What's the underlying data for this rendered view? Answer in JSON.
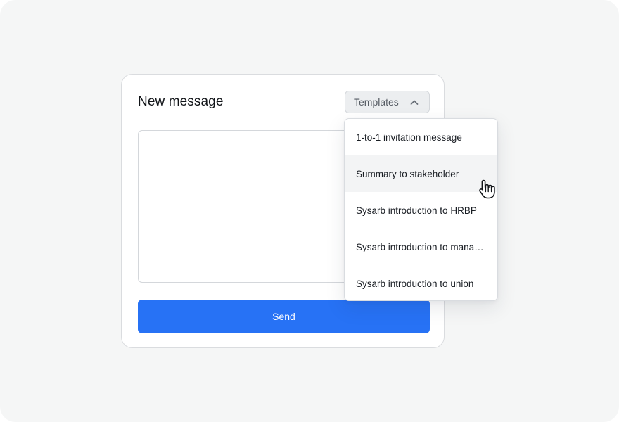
{
  "card": {
    "title": "New message",
    "templates_label": "Templates",
    "message_value": "",
    "send_label": "Send"
  },
  "dropdown": {
    "items": [
      {
        "label": "1-to-1 invitation message",
        "hovered": false
      },
      {
        "label": "Summary to stakeholder",
        "hovered": true
      },
      {
        "label": "Sysarb introduction to HRBP",
        "hovered": false
      },
      {
        "label": "Sysarb introduction to mana…",
        "hovered": false
      },
      {
        "label": "Sysarb introduction to union",
        "hovered": false
      }
    ]
  },
  "icons": {
    "templates_chevron": "chevron-up-icon",
    "pointer": "hand-pointer-cursor-icon"
  },
  "colors": {
    "background": "#f5f6f6",
    "card": "#ffffff",
    "accent": "#2772f5",
    "text": "#111418",
    "muted_text": "#555b63",
    "hover_row": "#f3f4f5"
  }
}
